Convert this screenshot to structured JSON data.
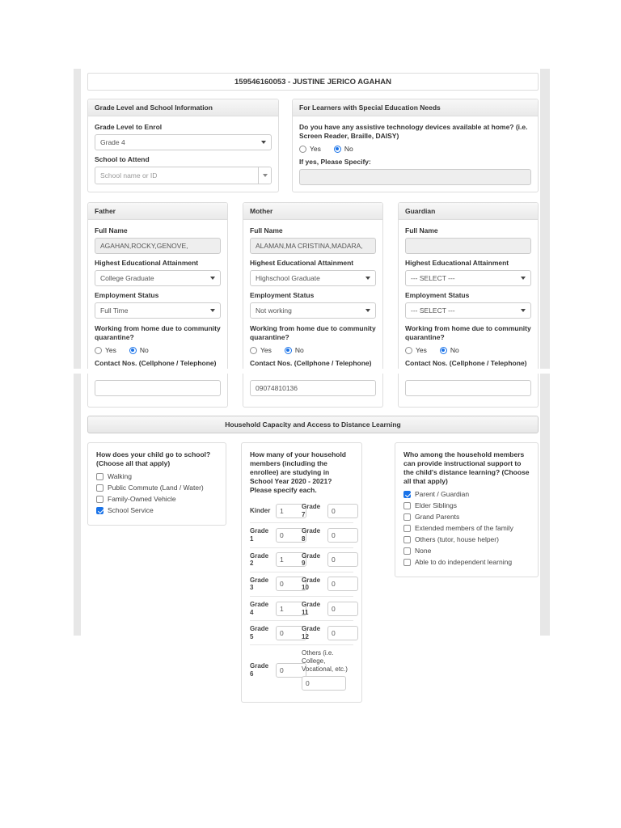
{
  "page": {
    "accent_blue": "#1a73e8"
  },
  "learner_header": {
    "title": "159546160053 - JUSTINE JERICO AGAHAN"
  },
  "grade_school": {
    "panel_title": "Grade Level and School Information",
    "grade_label": "Grade Level to Enrol",
    "grade_value": "Grade 4",
    "school_label": "School to Attend",
    "school_placeholder": "School name or ID"
  },
  "special_needs": {
    "panel_title": "For Learners with Special Education Needs",
    "question": "Do you have any assistive technology devices available at home? (i.e. Screen Reader, Braille, DAISY)",
    "yes_label": "Yes",
    "no_label": "No",
    "yes_checked": false,
    "no_checked": true,
    "specify_label": "If yes, Please Specify:",
    "specify_value": ""
  },
  "parent_labels": {
    "full_name": "Full Name",
    "education": "Highest Educational Attainment",
    "employment": "Employment Status",
    "wfh_question": "Working from home due to community quarantine?",
    "yes": "Yes",
    "no": "No",
    "contact": "Contact Nos. (Cellphone / Telephone)"
  },
  "parents": [
    {
      "title": "Father",
      "full_name": "AGAHAN,ROCKY,GENOVE,",
      "education": "College Graduate",
      "employment": "Full Time",
      "wfh_yes": false,
      "wfh_no": true,
      "contact": ""
    },
    {
      "title": "Mother",
      "full_name": "ALAMAN,MA CRISTINA,MADARA,",
      "education": "Highschool Graduate",
      "employment": "Not working",
      "wfh_yes": false,
      "wfh_no": true,
      "contact": "09074810136"
    },
    {
      "title": "Guardian",
      "full_name": "",
      "education": "--- SELECT ---",
      "employment": "--- SELECT ---",
      "wfh_yes": false,
      "wfh_no": true,
      "contact": ""
    }
  ],
  "household": {
    "section_title": "Household Capacity and Access to Distance Learning",
    "transport": {
      "question": "How does your child go to school? (Choose all that apply)",
      "options": [
        {
          "label": "Walking",
          "checked": false
        },
        {
          "label": "Public Commute (Land / Water)",
          "checked": false
        },
        {
          "label": "Family-Owned Vehicle",
          "checked": false
        },
        {
          "label": "School Service",
          "checked": true
        }
      ]
    },
    "members": {
      "question": "How many of your household members (including the enrollee) are studying in School Year 2020 - 2021? Please specify each.",
      "rows": [
        {
          "l_label": "Kinder",
          "l_value": "1",
          "r_label": "Grade 7",
          "r_value": "0"
        },
        {
          "l_label": "Grade 1",
          "l_value": "0",
          "r_label": "Grade 8",
          "r_value": "0"
        },
        {
          "l_label": "Grade 2",
          "l_value": "1",
          "r_label": "Grade 9",
          "r_value": "0"
        },
        {
          "l_label": "Grade 3",
          "l_value": "0",
          "r_label": "Grade 10",
          "r_value": "0"
        },
        {
          "l_label": "Grade 4",
          "l_value": "1",
          "r_label": "Grade 11",
          "r_value": "0"
        },
        {
          "l_label": "Grade 5",
          "l_value": "0",
          "r_label": "Grade 12",
          "r_value": "0"
        }
      ],
      "last_row": {
        "l_label": "Grade 6",
        "l_value": "0",
        "others_label": "Others (i.e. College, Vocational, etc.)",
        "others_value": "0"
      }
    },
    "support": {
      "question": "Who among the household members can provide instructional support to the child's distance learning? (Choose all that apply)",
      "options": [
        {
          "label": "Parent / Guardian",
          "checked": true
        },
        {
          "label": "Elder Siblings",
          "checked": false
        },
        {
          "label": "Grand Parents",
          "checked": false
        },
        {
          "label": "Extended members of the family",
          "checked": false
        },
        {
          "label": "Others (tutor, house helper)",
          "checked": false
        },
        {
          "label": "None",
          "checked": false
        },
        {
          "label": "Able to do independent learning",
          "checked": false
        }
      ]
    }
  }
}
